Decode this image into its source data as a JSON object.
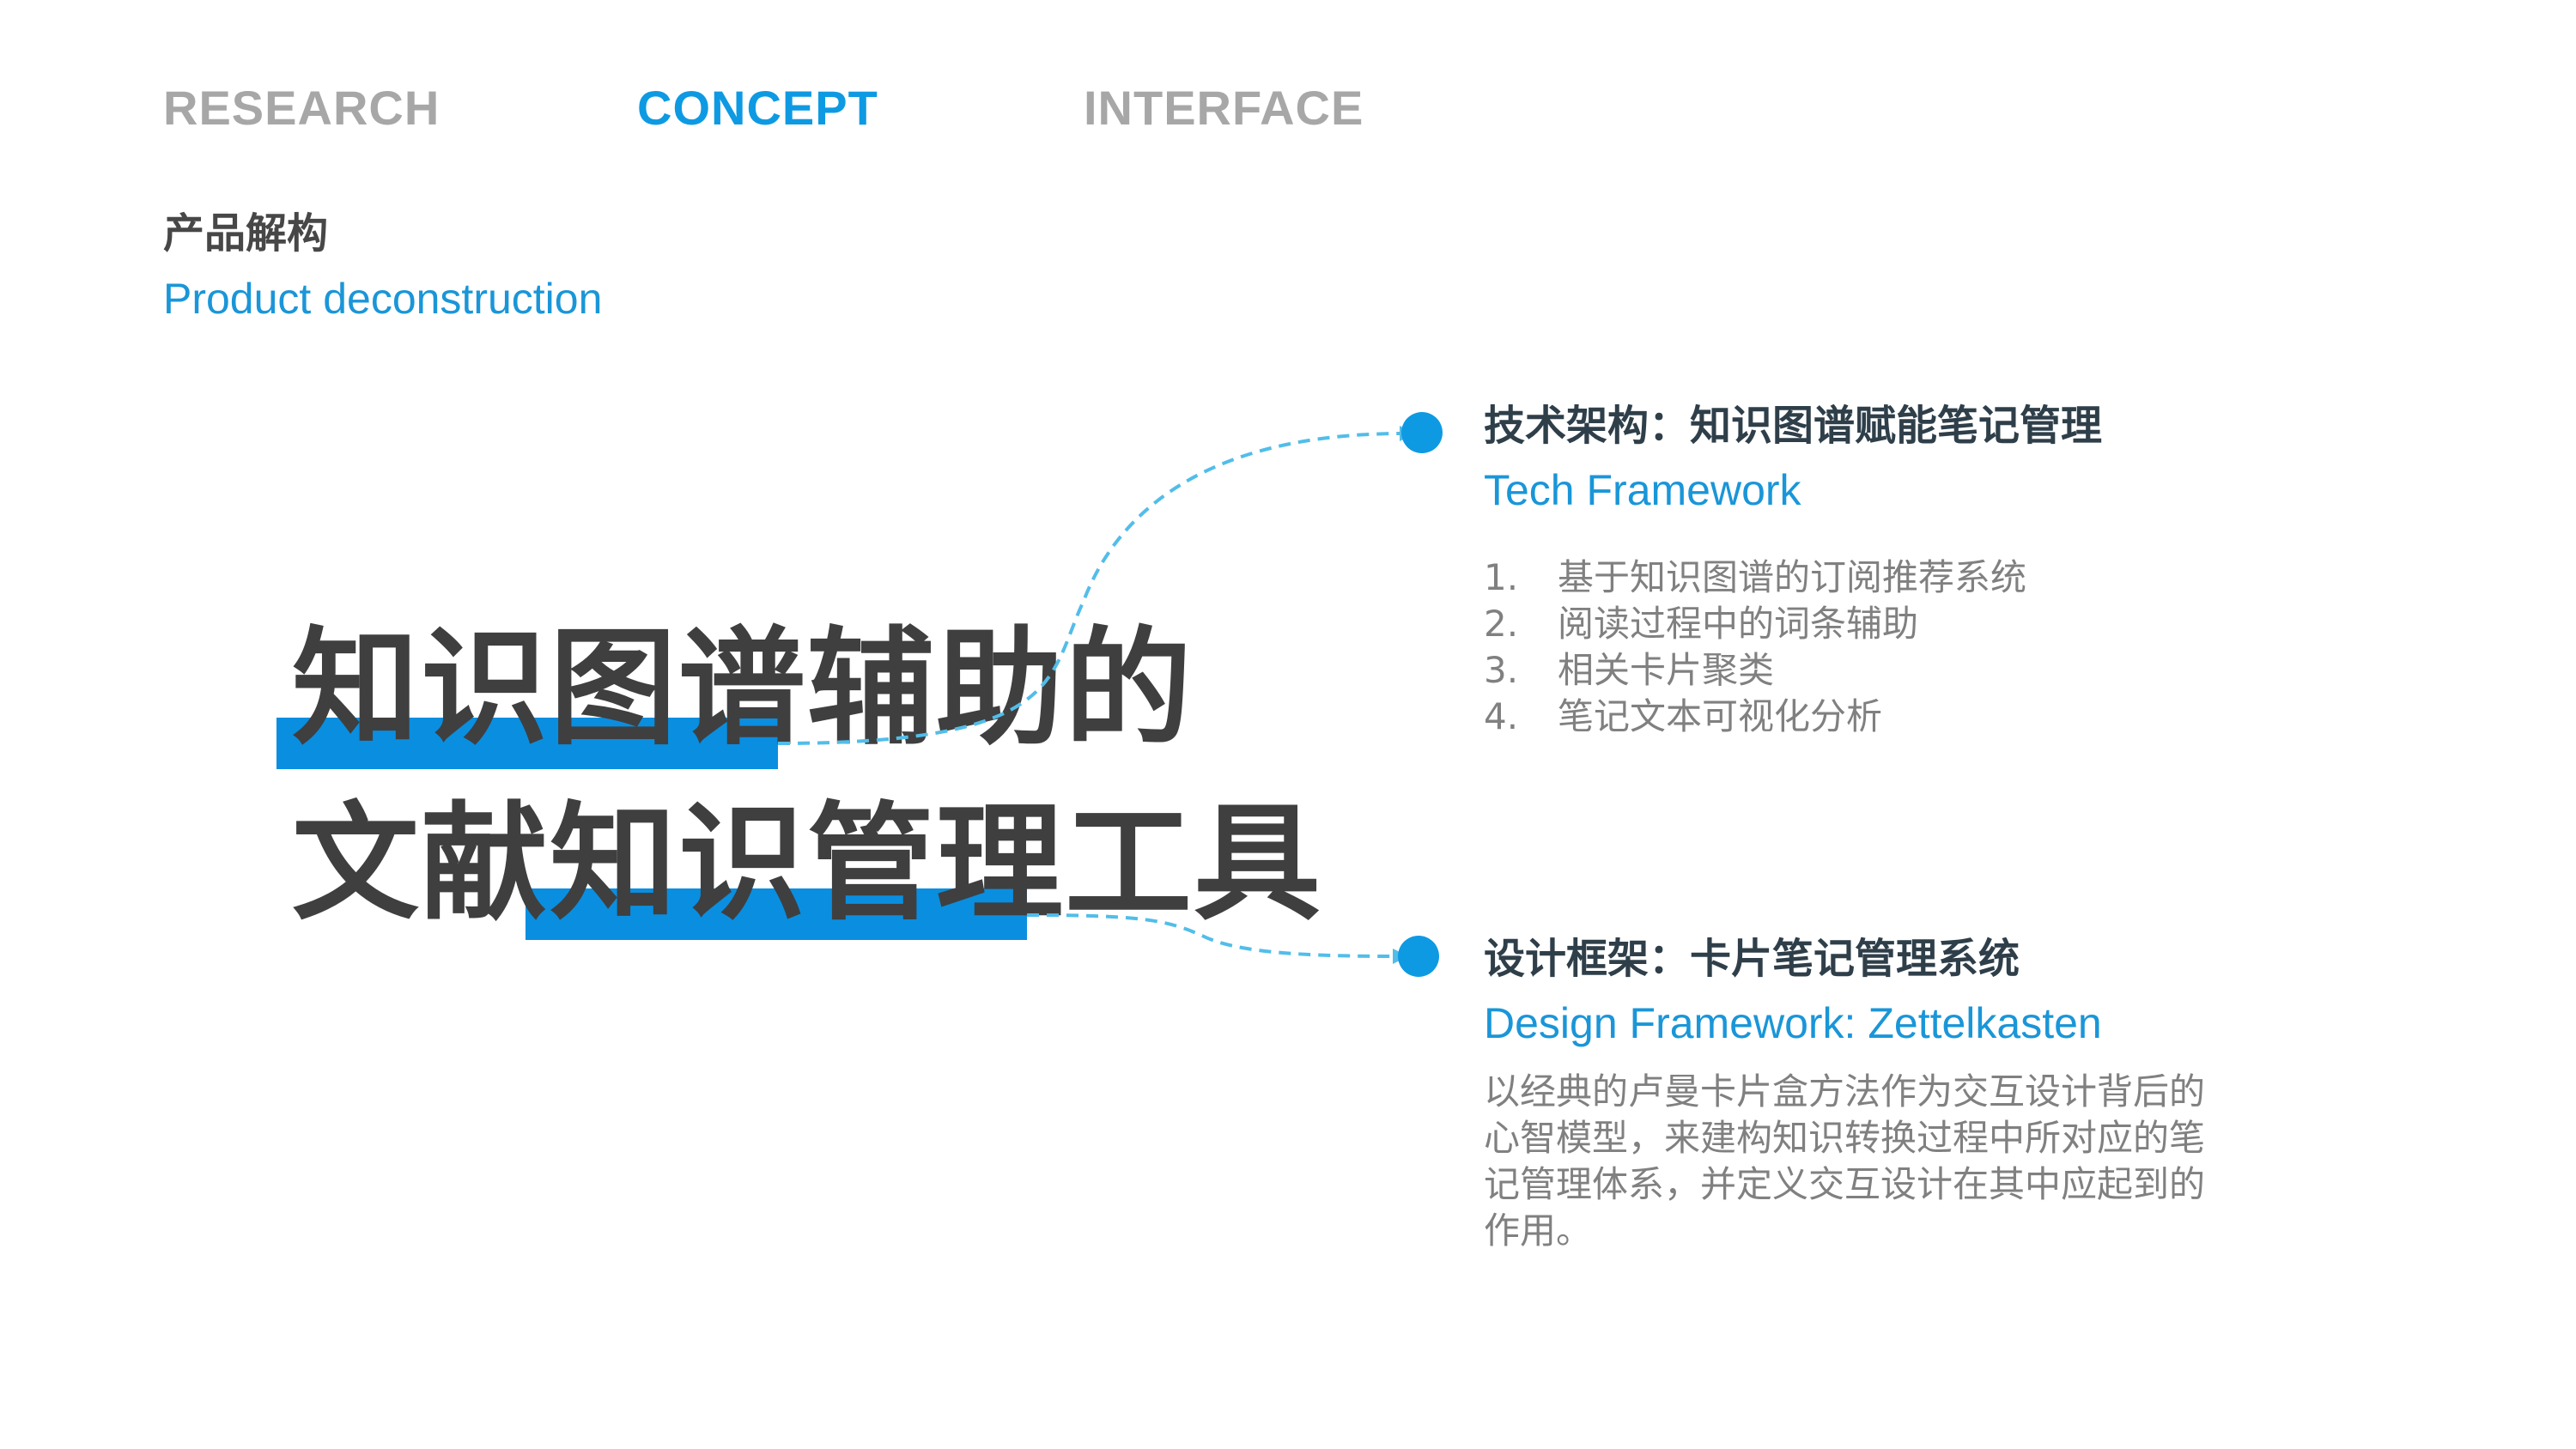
{
  "nav": {
    "tabs": [
      {
        "label": "RESEARCH",
        "active": false
      },
      {
        "label": "CONCEPT",
        "active": true
      },
      {
        "label": "INTERFACE",
        "active": false
      }
    ]
  },
  "section": {
    "title_cn": "产品解构",
    "title_en": "Product deconstruction"
  },
  "headline": {
    "line1": "知识图谱辅助的",
    "line2": "文献知识管理工具"
  },
  "tech": {
    "title_cn": "技术架构：知识图谱赋能笔记管理",
    "title_en": "Tech Framework",
    "items": [
      {
        "num": "1.",
        "text": "基于知识图谱的订阅推荐系统"
      },
      {
        "num": "2.",
        "text": "阅读过程中的词条辅助"
      },
      {
        "num": "3.",
        "text": "相关卡片聚类"
      },
      {
        "num": "4.",
        "text": "笔记文本可视化分析"
      }
    ]
  },
  "design": {
    "title_cn": "设计框架：卡片笔记管理系统",
    "title_en": "Design Framework: Zettelkasten",
    "description": "以经典的卢曼卡片盒方法作为交互设计背后的心智模型，来建构知识转换过程中所对应的笔记管理体系，并定义交互设计在其中应起到的作用。"
  },
  "colors": {
    "accent": "#0e9ae2",
    "nav_inactive": "#a7a7a7",
    "headline": "#3f3f3f",
    "body_text": "#808080"
  }
}
